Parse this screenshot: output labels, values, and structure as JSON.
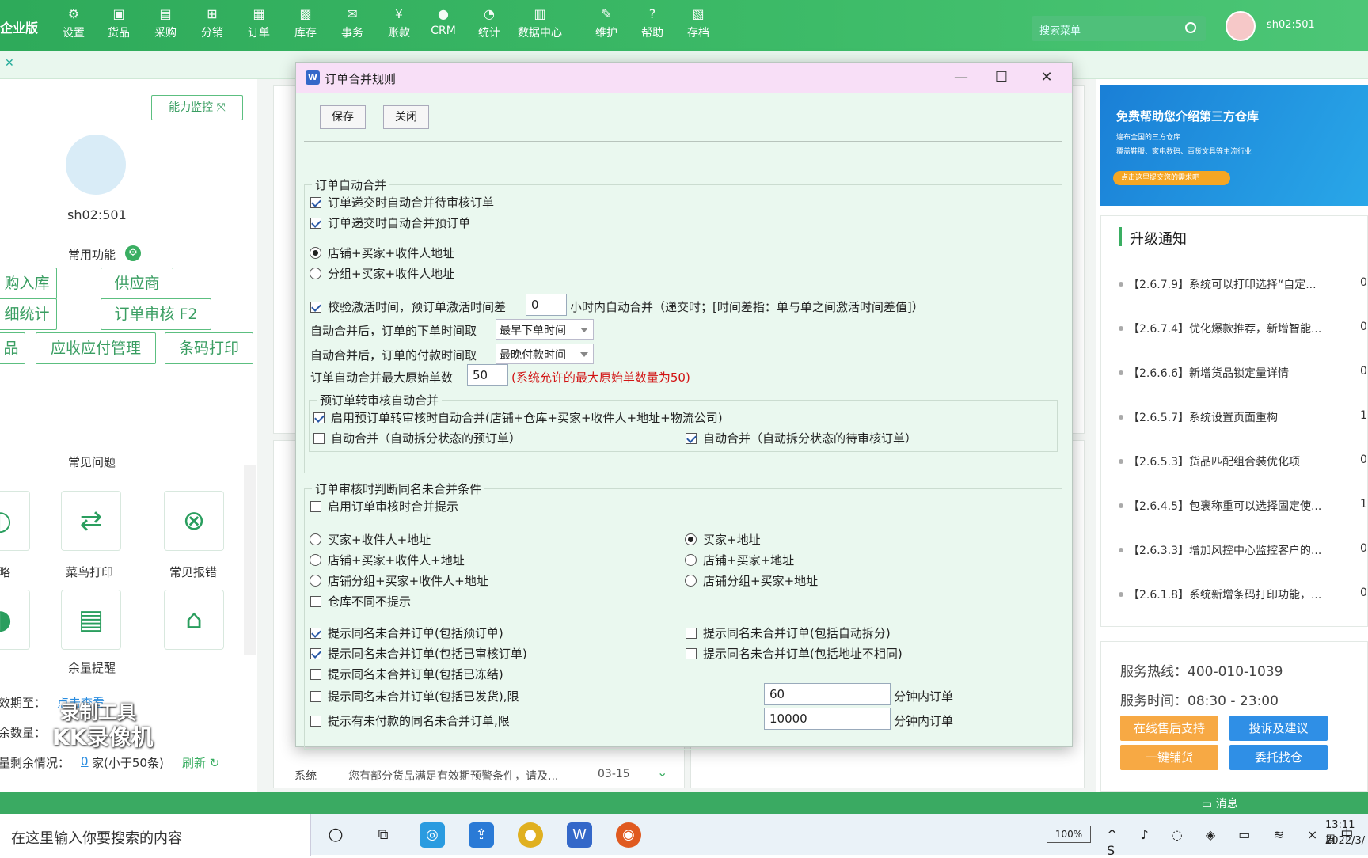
{
  "app": {
    "brand": "企业版"
  },
  "nav": [
    {
      "label": "设置",
      "icon": "gear-icon",
      "glyph": "⚙"
    },
    {
      "label": "货品",
      "icon": "box-icon",
      "glyph": "▣"
    },
    {
      "label": "采购",
      "icon": "cart-icon",
      "glyph": "▤"
    },
    {
      "label": "分销",
      "icon": "sitemap-icon",
      "glyph": "⊞"
    },
    {
      "label": "订单",
      "icon": "clipboard-icon",
      "glyph": "▦"
    },
    {
      "label": "库存",
      "icon": "grid-icon",
      "glyph": "▩"
    },
    {
      "label": "事务",
      "icon": "chat-icon",
      "glyph": "✉"
    },
    {
      "label": "账款",
      "icon": "yen-icon",
      "glyph": "¥"
    },
    {
      "label": "CRM",
      "icon": "user-icon",
      "glyph": "●"
    },
    {
      "label": "统计",
      "icon": "pie-icon",
      "glyph": "◔"
    },
    {
      "label": "数据中心",
      "icon": "bar-chart-icon",
      "glyph": "▥"
    },
    {
      "label": "维护",
      "icon": "wrench-icon",
      "glyph": "✎"
    },
    {
      "label": "帮助",
      "icon": "help-icon",
      "glyph": "?"
    },
    {
      "label": "存档",
      "icon": "archive-icon",
      "glyph": "▧"
    }
  ],
  "search": {
    "placeholder": "搜索菜单"
  },
  "user": {
    "name": "sh02:501"
  },
  "left": {
    "monitor": "能力监控",
    "username": "sh02:501",
    "common_title": "常用功能",
    "buttons": [
      "购入库",
      "供应商",
      "细统计",
      "订单审核 F2",
      "品",
      "应收应付管理",
      "条码打印"
    ],
    "faq_title": "常见问题",
    "tiles": [
      "略",
      "菜鸟打印",
      "常见报错"
    ],
    "remain_title": "余量提醒",
    "expire_label": "效期至：",
    "expire_link": "点击查看",
    "count_label": "余数量：",
    "left_label": "量剩余情况：",
    "left_value": "0",
    "left_unit": "家(小于50条)",
    "refresh": "刷新"
  },
  "watermark": {
    "line1": "录制工具",
    "line2": "KK录像机"
  },
  "mid": {
    "sys_label": "系统",
    "sys_msg": "您有部分货品满足有效期预警条件，请及...",
    "sys_date": "03-15"
  },
  "banner": {
    "title": "免费帮助您介绍第三方仓库",
    "sub1": "遍布全国的三方仓库",
    "sub2": "覆盖鞋服、家电数码、百货文具等主流行业",
    "cta": "点击这里提交您的需求吧"
  },
  "upgrade": {
    "title": "升级通知",
    "items": [
      {
        "text": "【2.6.7.9】系统可以打印选择“自定...",
        "n": "0"
      },
      {
        "text": "【2.6.7.4】优化爆款推荐，新增智能...",
        "n": "0"
      },
      {
        "text": "【2.6.6.6】新增货品锁定量详情",
        "n": "0"
      },
      {
        "text": "【2.6.5.7】系统设置页面重构",
        "n": "1"
      },
      {
        "text": "【2.6.5.3】货品匹配组合装优化项",
        "n": "0"
      },
      {
        "text": "【2.6.4.5】包裹称重可以选择固定使...",
        "n": "1"
      },
      {
        "text": "【2.6.3.3】增加风控中心监控客户的...",
        "n": "0"
      },
      {
        "text": "【2.6.1.8】系统新增条码打印功能，...",
        "n": "0"
      }
    ]
  },
  "service": {
    "hotline": "服务热线：400-010-1039",
    "hours": "服务时间：08:30 - 23:00",
    "btn1": "在线售后支持",
    "btn2": "投诉及建议",
    "btn3": "一键铺货",
    "btn4": "委托找仓"
  },
  "statusbar": {
    "msg": "消息"
  },
  "taskbar": {
    "search": "在这里输入你要搜索的内容",
    "battery": "100%",
    "time": "13:11 周",
    "date": "2022/3/"
  },
  "dialog": {
    "title": "订单合并规则",
    "save": "保存",
    "close": "关闭",
    "g1_title": "订单自动合并",
    "c1": "订单递交时自动合并待审核订单",
    "c2": "订单递交时自动合并预订单",
    "r1": "店铺+买家+收件人地址",
    "r2": "分组+买家+收件人地址",
    "c3a": "校验激活时间，预订单激活时间差",
    "c3_value": "0",
    "c3b": "小时内自动合并（递交时；[时间差指：单与单之间激活时间差值]）",
    "l_order_time": "自动合并后，订单的下单时间取",
    "order_time_sel": "最早下单时间",
    "l_pay_time": "自动合并后，订单的付款时间取",
    "pay_time_sel": "最晚付款时间",
    "l_max": "订单自动合并最大原始单数",
    "max_value": "50",
    "max_note": "(系统允许的最大原始单数量为50)",
    "g2_title": "预订单转审核自动合并",
    "c4": "启用预订单转审核时自动合并(店铺+仓库+买家+收件人+地址+物流公司)",
    "c5": "自动合并（自动拆分状态的预订单）",
    "c6": "自动合并（自动拆分状态的待审核订单）",
    "g3_title": "订单审核时判断同名未合并条件",
    "c7": "启用订单审核时合并提示",
    "r3": "买家+收件人+地址",
    "r4": "买家+地址",
    "r5": "店铺+买家+收件人+地址",
    "r6": "店铺+买家+地址",
    "r7": "店铺分组+买家+收件人+地址",
    "r8": "店铺分组+买家+地址",
    "c8": "仓库不同不提示",
    "c9": "提示同名未合并订单(包括预订单)",
    "c10": "提示同名未合并订单(包括自动拆分)",
    "c11": "提示同名未合并订单(包括已审核订单)",
    "c12": "提示同名未合并订单(包括地址不相同)",
    "c13": "提示同名未合并订单(包括已冻结)",
    "c14": "提示同名未合并订单(包括已发货),限",
    "c14_value": "60",
    "c14_unit": "分钟内订单",
    "c15": "提示有未付款的同名未合并订单,限",
    "c15_value": "10000",
    "c15_unit": "分钟内订单"
  }
}
